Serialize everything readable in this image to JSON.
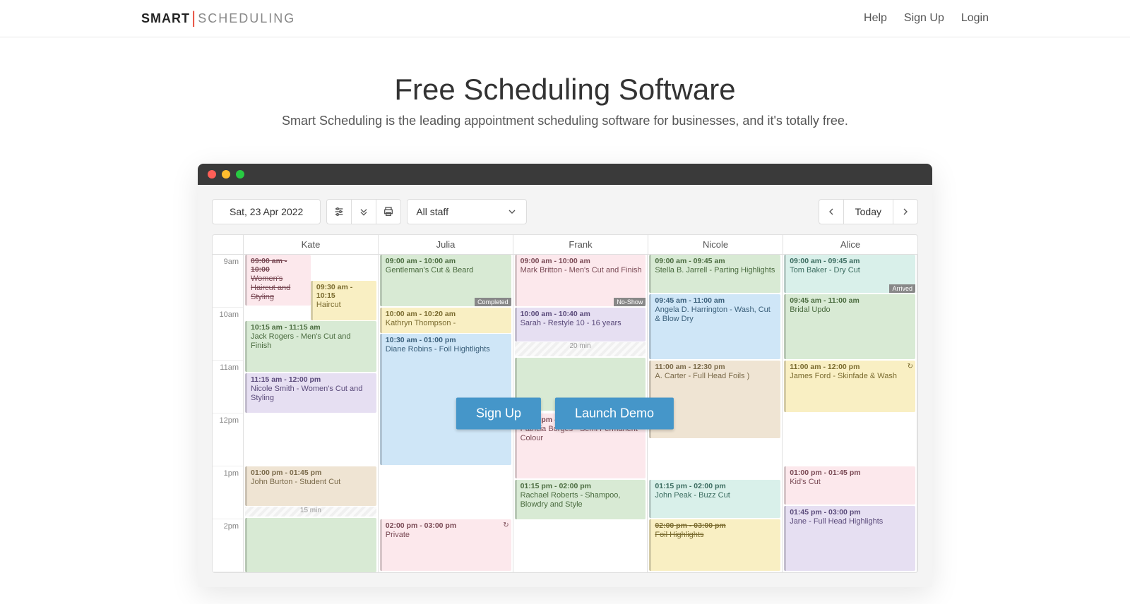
{
  "nav": {
    "help": "Help",
    "signup": "Sign Up",
    "login": "Login"
  },
  "logo": {
    "part1": "SMART",
    "part2": "SCHEDULING"
  },
  "hero": {
    "title": "Free Scheduling Software",
    "subtitle": "Smart Scheduling is the leading appointment scheduling software for businesses, and it's totally free."
  },
  "toolbar": {
    "date": "Sat, 23 Apr 2022",
    "staff": "All staff",
    "today": "Today"
  },
  "cta": {
    "signup": "Sign Up",
    "demo": "Launch Demo"
  },
  "timeLabels": [
    "9am",
    "10am",
    "11am",
    "12pm",
    "1pm",
    "2pm"
  ],
  "columns": [
    "Kate",
    "Julia",
    "Frank",
    "Nicole",
    "Alice"
  ],
  "badges": {
    "completed": "Completed",
    "noshow": "No-Show",
    "arrived": "Arrived"
  },
  "gaps": {
    "kate_15": "15 min",
    "frank_20": "20 min"
  },
  "events": {
    "kate": [
      {
        "time": "09:00 am - 10:00",
        "title": "Women's Haircut and Styling",
        "strike": true
      },
      {
        "time": "09:30 am - 10:15",
        "title": "Haircut"
      },
      {
        "time": "10:15 am - 11:15 am",
        "title": "Jack Rogers - Men's Cut and Finish"
      },
      {
        "time": "11:15 am - 12:00 pm",
        "title": "Nicole Smith - Women's Cut and Styling"
      },
      {
        "time": "01:00 pm - 01:45 pm",
        "title": "John Burton - Student Cut"
      }
    ],
    "julia": [
      {
        "time": "09:00 am - 10:00 am",
        "title": "Gentleman's Cut & Beard"
      },
      {
        "time": "10:00 am - 10:20 am",
        "title": "Kathryn Thompson -"
      },
      {
        "time": "10:30 am - 01:00 pm",
        "title": "Diane Robins - Foil Hightlights"
      },
      {
        "time": "02:00 pm - 03:00 pm",
        "title": "Private"
      }
    ],
    "frank": [
      {
        "time": "09:00 am - 10:00 am",
        "title": "Mark Britton - Men's Cut and Finish"
      },
      {
        "time": "10:00 am - 10:40 am",
        "title": "Sarah - Restyle 10 - 16 years"
      },
      {
        "time": "12:00 pm - 01:15 pm",
        "title": "Patricia Borges - Semi Permanent Colour"
      },
      {
        "time": "01:15 pm - 02:00 pm",
        "title": "Rachael Roberts - Shampoo, Blowdry and Style"
      }
    ],
    "nicole": [
      {
        "time": "09:00 am - 09:45 am",
        "title": "Stella B. Jarrell - Parting Highlights"
      },
      {
        "time": "09:45 am - 11:00 am",
        "title": "Angela D. Harrington - Wash, Cut & Blow Dry"
      },
      {
        "time": "11:00 am - 12:30 pm",
        "title": "A. Carter - Full Head Foils )"
      },
      {
        "time": "01:15 pm - 02:00 pm",
        "title": "John Peak - Buzz Cut"
      },
      {
        "time": "02:00 pm - 03:00 pm",
        "title": "Foil Highlights",
        "strike": true
      }
    ],
    "alice": [
      {
        "time": "09:00 am - 09:45 am",
        "title": "Tom Baker - Dry Cut"
      },
      {
        "time": "09:45 am - 11:00 am",
        "title": "Bridal Updo"
      },
      {
        "time": "11:00 am - 12:00 pm",
        "title": "James Ford - Skinfade & Wash"
      },
      {
        "time": "01:00 pm - 01:45 pm",
        "title": "Kid's Cut"
      },
      {
        "time": "01:45 pm - 03:00 pm",
        "title": "Jane - Full Head Highlights"
      }
    ]
  }
}
